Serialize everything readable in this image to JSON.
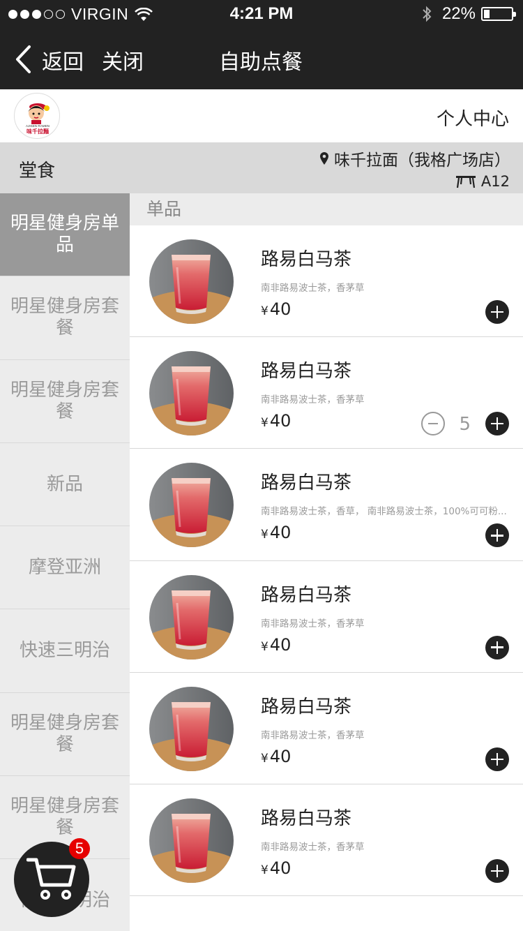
{
  "status_bar": {
    "carrier": "VIRGIN",
    "time": "4:21 PM",
    "battery_text": "22%",
    "battery_level": 0.22,
    "signal_strength": 3
  },
  "nav": {
    "back_label": "返回",
    "close_label": "关闭",
    "title": "自助点餐"
  },
  "store": {
    "logo_text_en": "AJISEN RAMEN",
    "logo_text_cn": "味千拉麵",
    "user_center": "个人中心",
    "dine_mode": "堂食",
    "location": "味千拉面（我格广场店）",
    "table": "A12"
  },
  "categories": [
    {
      "label": "明星健身房单品",
      "active": true
    },
    {
      "label": "明星健身房套餐",
      "active": false
    },
    {
      "label": "明星健身房套餐",
      "active": false
    },
    {
      "label": "新品",
      "active": false
    },
    {
      "label": "摩登亚洲",
      "active": false
    },
    {
      "label": "快速三明治",
      "active": false
    },
    {
      "label": "明星健身房套餐",
      "active": false
    },
    {
      "label": "明星健身房套餐",
      "active": false
    },
    {
      "label": "快速三明治",
      "active": false
    }
  ],
  "section": {
    "title": "单品"
  },
  "products": [
    {
      "name": "路易白马茶",
      "desc": "南非路易波士茶，香茅草",
      "currency": "¥",
      "price": "40",
      "qty": null
    },
    {
      "name": "路易白马茶",
      "desc": "南非路易波士茶，香茅草",
      "currency": "¥",
      "price": "40",
      "qty": "5"
    },
    {
      "name": "路易白马茶",
      "desc": "南非路易波士茶，香草， 南非路易波士茶，100%可可粉...",
      "currency": "¥",
      "price": "40",
      "qty": null
    },
    {
      "name": "路易白马茶",
      "desc": "南非路易波士茶，香茅草",
      "currency": "¥",
      "price": "40",
      "qty": null
    },
    {
      "name": "路易白马茶",
      "desc": "南非路易波士茶，香茅草",
      "currency": "¥",
      "price": "40",
      "qty": null
    },
    {
      "name": "路易白马茶",
      "desc": "南非路易波士茶，香茅草",
      "currency": "¥",
      "price": "40",
      "qty": null
    }
  ],
  "cart": {
    "count": "5"
  },
  "colors": {
    "bar_bg": "#222222",
    "active_category": "#999999",
    "sidebar_bg": "#ececec",
    "badge": "#e60000"
  }
}
